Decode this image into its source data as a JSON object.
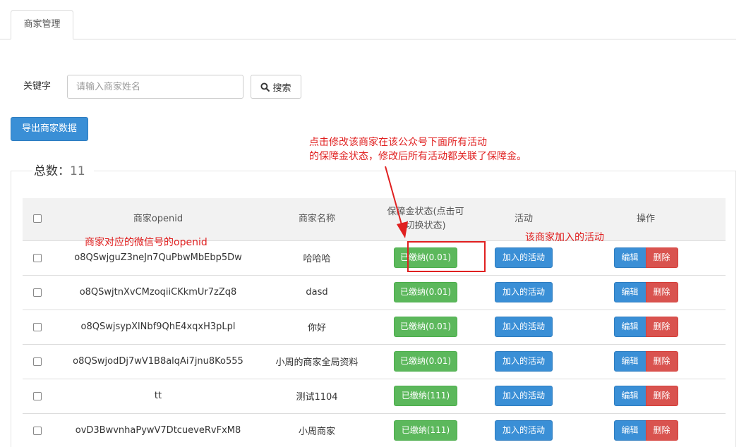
{
  "tabs": [
    {
      "label": "商家管理"
    }
  ],
  "search": {
    "label": "关键字",
    "placeholder": "请输入商家姓名",
    "button_label": "搜索"
  },
  "export_button": "导出商家数据",
  "summary": {
    "label": "总数：",
    "count": "11"
  },
  "table": {
    "headers": {
      "openid": "商家openid",
      "name": "商家名称",
      "deposit": "保障金状态(点击可",
      "deposit2": "切换状态)",
      "activity": "活动",
      "ops": "操作"
    },
    "rows": [
      {
        "openid": "o8QSwjguZ3neJn7QuPbwMbEbp5Dw",
        "name": "哈哈哈",
        "deposit": "已缴纳(0.01)",
        "activity": "加入的活动",
        "edit": "编辑",
        "delete": "删除"
      },
      {
        "openid": "o8QSwjtnXvCMzoqiiCKkmUr7zZq8",
        "name": "dasd",
        "deposit": "已缴纳(0.01)",
        "activity": "加入的活动",
        "edit": "编辑",
        "delete": "删除"
      },
      {
        "openid": "o8QSwjsypXlNbf9QhE4xqxH3pLpl",
        "name": "你好",
        "deposit": "已缴纳(0.01)",
        "activity": "加入的活动",
        "edit": "编辑",
        "delete": "删除"
      },
      {
        "openid": "o8QSwjodDj7wV1B8alqAi7jnu8Ko555",
        "name": "小周的商家全局资料",
        "deposit": "已缴纳(0.01)",
        "activity": "加入的活动",
        "edit": "编辑",
        "delete": "删除"
      },
      {
        "openid": "tt",
        "name": "测试1104",
        "deposit": "已缴纳(111)",
        "activity": "加入的活动",
        "edit": "编辑",
        "delete": "删除"
      },
      {
        "openid": "ovD3BwvnhaPywV7DtcueveRvFxM8",
        "name": "小周商家",
        "deposit": "已缴纳(111)",
        "activity": "加入的活动",
        "edit": "编辑",
        "delete": "删除"
      }
    ]
  },
  "annotations": {
    "top_line1": "点击修改该商家在该公众号下面所有活动",
    "top_line2": "的保障金状态，修改后所有活动都关联了保障金。",
    "openid_note": "商家对应的微信号的openid",
    "activity_note": "该商家加入的活动"
  },
  "colors": {
    "primary": "#3a8fd6",
    "success": "#5cb85c",
    "danger": "#d9534f",
    "annotation": "#e02020"
  }
}
